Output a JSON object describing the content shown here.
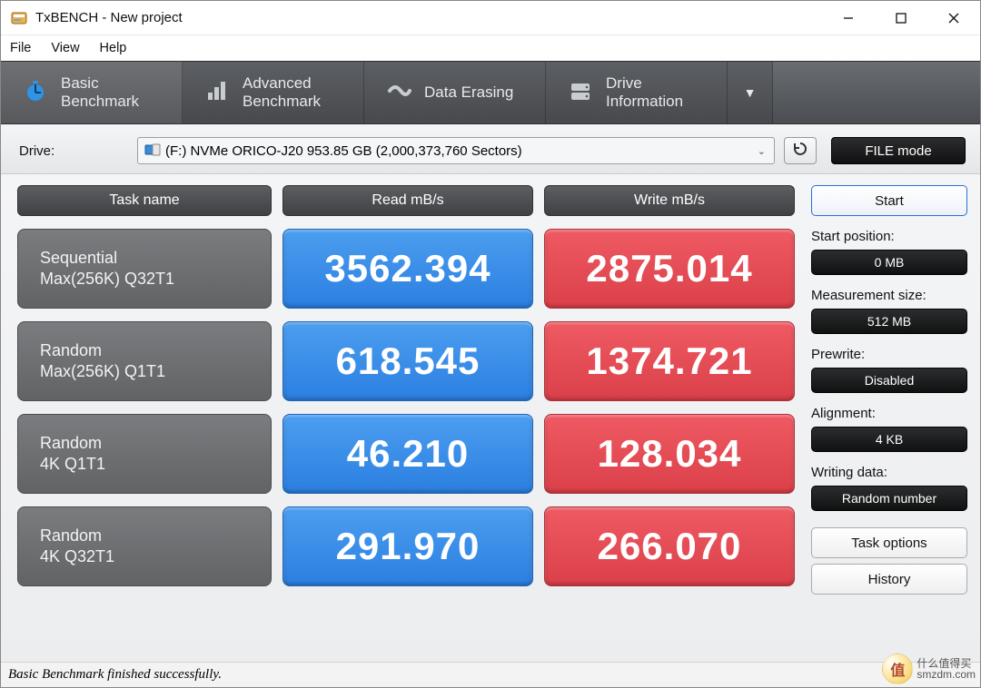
{
  "window": {
    "title": "TxBENCH - New project"
  },
  "menu": {
    "file": "File",
    "view": "View",
    "help": "Help"
  },
  "tabs": {
    "basic": {
      "l1": "Basic",
      "l2": "Benchmark"
    },
    "advanced": {
      "l1": "Advanced",
      "l2": "Benchmark"
    },
    "erase": {
      "l1": "Data Erasing",
      "l2": ""
    },
    "info": {
      "l1": "Drive",
      "l2": "Information"
    }
  },
  "drive": {
    "label": "Drive:",
    "selected": "(F:) NVMe ORICO-J20  953.85 GB (2,000,373,760 Sectors)",
    "filemode": "FILE mode"
  },
  "grid": {
    "headers": {
      "task": "Task name",
      "read": "Read mB/s",
      "write": "Write mB/s"
    },
    "rows": [
      {
        "name_l1": "Sequential",
        "name_l2": "Max(256K) Q32T1",
        "read": "3562.394",
        "write": "2875.014"
      },
      {
        "name_l1": "Random",
        "name_l2": "Max(256K) Q1T1",
        "read": "618.545",
        "write": "1374.721"
      },
      {
        "name_l1": "Random",
        "name_l2": "4K Q1T1",
        "read": "46.210",
        "write": "128.034"
      },
      {
        "name_l1": "Random",
        "name_l2": "4K Q32T1",
        "read": "291.970",
        "write": "266.070"
      }
    ]
  },
  "sidebar": {
    "start": "Start",
    "startpos_lbl": "Start position:",
    "startpos_val": "0 MB",
    "size_lbl": "Measurement size:",
    "size_val": "512 MB",
    "prewrite_lbl": "Prewrite:",
    "prewrite_val": "Disabled",
    "align_lbl": "Alignment:",
    "align_val": "4 KB",
    "wdata_lbl": "Writing data:",
    "wdata_val": "Random number",
    "taskopts": "Task options",
    "history": "History"
  },
  "status": "Basic Benchmark finished successfully.",
  "watermark": {
    "char": "值",
    "t1": "什么值得买",
    "t2": "smzdm.com"
  },
  "chart_data": {
    "type": "table",
    "title": "TxBENCH Basic Benchmark",
    "columns": [
      "Task name",
      "Read mB/s",
      "Write mB/s"
    ],
    "rows": [
      [
        "Sequential Max(256K) Q32T1",
        3562.394,
        2875.014
      ],
      [
        "Random Max(256K) Q1T1",
        618.545,
        1374.721
      ],
      [
        "Random 4K Q1T1",
        46.21,
        128.034
      ],
      [
        "Random 4K Q32T1",
        291.97,
        266.07
      ]
    ]
  }
}
